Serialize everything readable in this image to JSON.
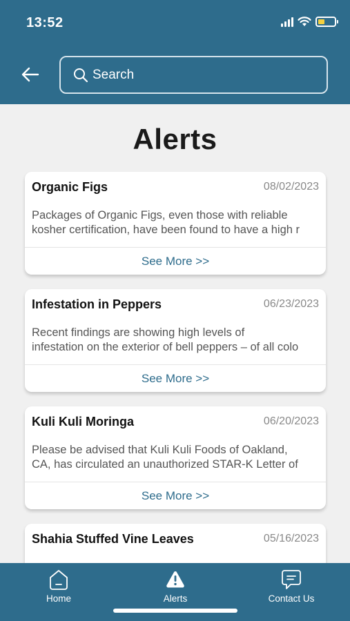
{
  "status_bar": {
    "time": "13:52"
  },
  "search": {
    "placeholder": "Search"
  },
  "page": {
    "title": "Alerts"
  },
  "alerts": [
    {
      "title": "Organic Figs",
      "date": "08/02/2023",
      "summary_lines": [
        "Packages of Organic Figs, even those with reliable",
        "kosher certification, have been found to have a high r"
      ],
      "link": "See More >>"
    },
    {
      "title": "Infestation in Peppers",
      "date": "06/23/2023",
      "summary_lines": [
        "Recent findings are showing high levels of",
        "infestation on the exterior of bell peppers – of all colo"
      ],
      "link": "See More >>"
    },
    {
      "title": "Kuli Kuli Moringa",
      "date": "06/20/2023",
      "summary_lines": [
        "Please be advised that Kuli Kuli Foods of Oakland,",
        "CA, has circulated an unauthorized STAR-K Letter of"
      ],
      "link": "See More >>"
    },
    {
      "title": "Shahia Stuffed Vine Leaves",
      "date": "05/16/2023"
    }
  ],
  "bottom_nav": [
    {
      "label": "Home",
      "icon": "home-icon"
    },
    {
      "label": "Alerts",
      "icon": "alert-icon"
    },
    {
      "label": "Contact Us",
      "icon": "chat-icon"
    }
  ],
  "colors": {
    "primary": "#2e6c8c",
    "background": "#f0f0f0",
    "battery": "#f4d03f"
  }
}
